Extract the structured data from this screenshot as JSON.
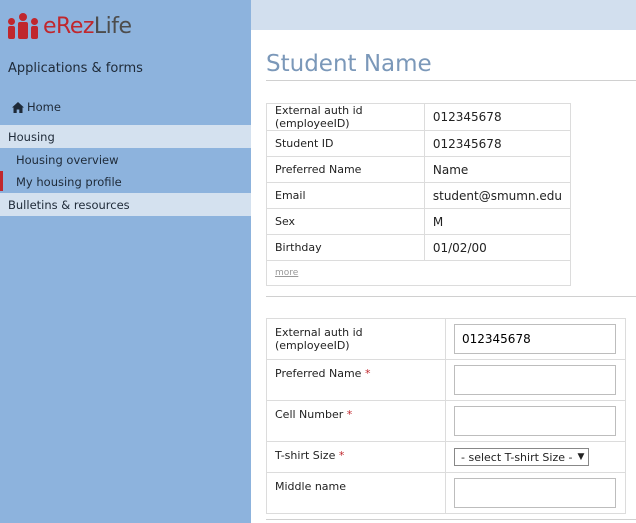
{
  "brand": {
    "name_prefix": "eRez",
    "name_suffix": "Life"
  },
  "sidebar": {
    "title": "Applications & forms",
    "home": "Home",
    "section_housing": "Housing",
    "items": [
      "Housing overview",
      "My housing profile"
    ],
    "section_bulletins": "Bulletins & resources",
    "active_item": "My housing profile"
  },
  "page": {
    "title": "Student Name"
  },
  "profile": {
    "rows": [
      {
        "label": "External auth id (employeeID)",
        "value": "012345678"
      },
      {
        "label": "Student ID",
        "value": "012345678"
      },
      {
        "label": "Preferred Name",
        "value": "Name"
      },
      {
        "label": "Email",
        "value": "student@smumn.edu"
      },
      {
        "label": "Sex",
        "value": "M"
      },
      {
        "label": "Birthday",
        "value": "01/02/00"
      }
    ],
    "more_link": "more"
  },
  "form": {
    "fields": [
      {
        "label": "External auth id (employeeID)",
        "required": false,
        "value": "012345678"
      },
      {
        "label": "Preferred Name",
        "required": true,
        "value": ""
      },
      {
        "label": "Cell Number",
        "required": true,
        "value": ""
      },
      {
        "label": "T-shirt Size",
        "required": true,
        "value": "- select T-shirt Size -"
      },
      {
        "label": "Middle name",
        "required": false,
        "value": ""
      }
    ],
    "required_marker": "*"
  },
  "colors": {
    "brand_red": "#c0272d",
    "sidebar_blue": "#8db3dd",
    "title_blue": "#7b98b9"
  }
}
